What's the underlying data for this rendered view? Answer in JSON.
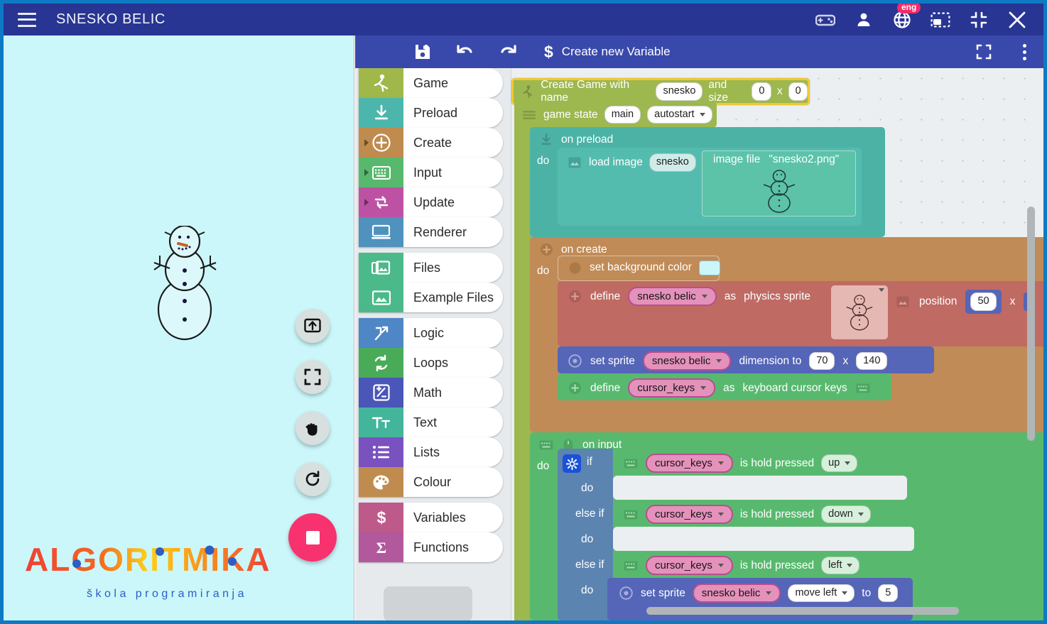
{
  "window": {
    "title": "SNESKO BELIC",
    "menu_icon": "hamburger-icon",
    "icons": [
      {
        "name": "gamepad-icon",
        "label": "Gamepad"
      },
      {
        "name": "account-icon",
        "label": "Account"
      },
      {
        "name": "language-globe-icon",
        "label": "Language",
        "badge": "eng"
      },
      {
        "name": "restore-window-icon",
        "label": "Restore"
      },
      {
        "name": "minimize-window-icon",
        "label": "Minimize"
      },
      {
        "name": "close-window-icon",
        "label": "Close"
      }
    ]
  },
  "canvas": {
    "background_color": "#cbf7fb",
    "sprite_name": "snesko belic",
    "buttons": [
      {
        "name": "export-button",
        "icon": "export-icon"
      },
      {
        "name": "fullscreen-button",
        "icon": "fullscreen-icon"
      },
      {
        "name": "pan-hand-button",
        "icon": "hand-icon"
      },
      {
        "name": "restart-button",
        "icon": "refresh-icon"
      },
      {
        "name": "stop-button",
        "icon": "stop-square-icon",
        "color": "#f8326f"
      }
    ],
    "logo": {
      "letters": [
        {
          "ch": "Λ",
          "color": "#ef4136"
        },
        {
          "ch": "L",
          "color": "#ef4136"
        },
        {
          "ch": "G",
          "color": "#f5802a"
        },
        {
          "ch": "O",
          "color": "#f79520"
        },
        {
          "ch": "R",
          "color": "#f7941e"
        },
        {
          "ch": "I",
          "color": "#fbb040"
        },
        {
          "ch": "T",
          "color": "#fdd017"
        },
        {
          "ch": "M",
          "color": "#f7941e"
        },
        {
          "ch": "I",
          "color": "#f7941e"
        },
        {
          "ch": "K",
          "color": "#f26722"
        },
        {
          "ch": "Λ",
          "color": "#ef4136"
        }
      ],
      "wordmark": "ALGORITMIKA",
      "tagline": "škola programiranja",
      "tagline_color": "#2d5ec4",
      "dot_color": "#2d5ec4"
    }
  },
  "editor_toolbar": {
    "save_label": "save-icon",
    "undo_label": "undo-icon",
    "redo_label": "redo-icon",
    "create_variable": {
      "symbol": "$",
      "label": "Create new Variable"
    },
    "fullscreen": "fullscreen-icon",
    "more": "more-vertical-icon"
  },
  "toolbox": {
    "groups": [
      {
        "items": [
          {
            "label": "Game",
            "color": "#a0b84a",
            "icon": "runner-icon",
            "expandable": false
          },
          {
            "label": "Preload",
            "color": "#4db6ac",
            "icon": "download-icon",
            "expandable": false
          },
          {
            "label": "Create",
            "color": "#c08b4e",
            "icon": "plus-circle-icon",
            "expandable": true
          },
          {
            "label": "Input",
            "color": "#58b96e",
            "icon": "keyboard-icon",
            "expandable": true
          },
          {
            "label": "Update",
            "color": "#bd52a4",
            "icon": "loop-arrows-icon",
            "expandable": true
          },
          {
            "label": "Renderer",
            "color": "#4f92bd",
            "icon": "monitor-icon",
            "expandable": false
          }
        ]
      },
      {
        "items": [
          {
            "label": "Files",
            "color": "#4cb98a",
            "icon": "image-folder-icon",
            "expandable": false
          },
          {
            "label": "Example Files",
            "color": "#4cb98a",
            "icon": "image-icon",
            "expandable": false
          }
        ]
      },
      {
        "items": [
          {
            "label": "Logic",
            "color": "#4f86c6",
            "icon": "branch-icon",
            "expandable": false
          },
          {
            "label": "Loops",
            "color": "#49ab58",
            "icon": "refresh-loop-icon",
            "expandable": false
          },
          {
            "label": "Math",
            "color": "#4a56b8",
            "icon": "plus-minus-icon",
            "expandable": false
          },
          {
            "label": "Text",
            "color": "#43b59b",
            "icon": "text-icon",
            "expandable": false
          },
          {
            "label": "Lists",
            "color": "#7a52c0",
            "icon": "list-icon",
            "expandable": false
          },
          {
            "label": "Colour",
            "color": "#c08b4e",
            "icon": "palette-icon",
            "expandable": false
          }
        ]
      },
      {
        "items": [
          {
            "label": "Variables",
            "color": "#bd5a8a",
            "icon": "dollar-icon",
            "expandable": false
          },
          {
            "label": "Functions",
            "color": "#b2589c",
            "icon": "sigma-icon",
            "expandable": false
          }
        ]
      }
    ]
  },
  "blocks": {
    "create_game": {
      "text_before": "Create Game with name",
      "name_value": "snesko",
      "text_mid": "and size",
      "width_value": "0",
      "x_sep": "x",
      "height_value": "0",
      "color": "#9cb84f",
      "selected": true,
      "icon": "runner-icon"
    },
    "game_state": {
      "label": "game state",
      "state_value": "main",
      "autostart_value": "autostart",
      "color": "#9cb84f",
      "icon": "lines-icon"
    },
    "on_preload": {
      "label": "on preload",
      "do_label": "do",
      "color": "#4cb2a6",
      "icon": "download-icon",
      "load_image": {
        "label": "load image",
        "variable": "snesko",
        "icon": "image-icon",
        "file_label": "image file",
        "file_value": "\"snesko2.png\"",
        "preview": "snowman-thumbnail"
      }
    },
    "on_create": {
      "label": "on create",
      "do_label": "do",
      "color": "#c08b57",
      "icon": "plus-circle-icon",
      "set_background": {
        "label": "set background color",
        "color_value": "#cbf7fb",
        "color": "#c08b57",
        "icon": "circle-icon"
      },
      "define_sprite": {
        "label": "define",
        "variable": "snesko belic",
        "as_label": "as",
        "type_label": "physics sprite",
        "image_icon": "image-icon",
        "position_label": "position",
        "position_x": "50",
        "x_sep": "x",
        "color": "#bf6a63",
        "icon": "plus-circle-icon",
        "preview": "snowman-thumbnail"
      },
      "set_dimension": {
        "label": "set sprite",
        "variable": "snesko belic",
        "mid_label": "dimension to",
        "width": "70",
        "x_sep": "x",
        "height": "140",
        "color": "#5565b8",
        "icon": "target-icon"
      },
      "define_keys": {
        "label": "define",
        "variable": "cursor_keys",
        "as_label": "as",
        "type_label": "keyboard cursor keys",
        "color": "#58b96e",
        "icon": "plus-circle-icon",
        "trailing_icon": "keyboard-icon"
      }
    },
    "on_input": {
      "label": "on input",
      "do_label": "do",
      "color": "#58b96e",
      "icons": [
        "keyboard-icon",
        "mouse-icon"
      ],
      "if_block": {
        "color": "#5b84b1",
        "gear_icon": "gear-icon",
        "if_label": "if",
        "do_label": "do",
        "elseif_label": "else if",
        "conditions": [
          {
            "variable": "cursor_keys",
            "label": "is hold pressed",
            "key": "up",
            "color": "#58b96e",
            "icon": "keyboard-icon"
          },
          {
            "variable": "cursor_keys",
            "label": "is hold pressed",
            "key": "down",
            "color": "#58b96e",
            "icon": "keyboard-icon"
          },
          {
            "variable": "cursor_keys",
            "label": "is hold pressed",
            "key": "left",
            "color": "#58b96e",
            "icon": "keyboard-icon"
          }
        ],
        "last_action": {
          "label": "set sprite",
          "variable": "snesko belic",
          "direction": "move left",
          "to_label": "to",
          "value": "5",
          "color": "#5565b8",
          "icon": "target-icon"
        }
      }
    }
  }
}
